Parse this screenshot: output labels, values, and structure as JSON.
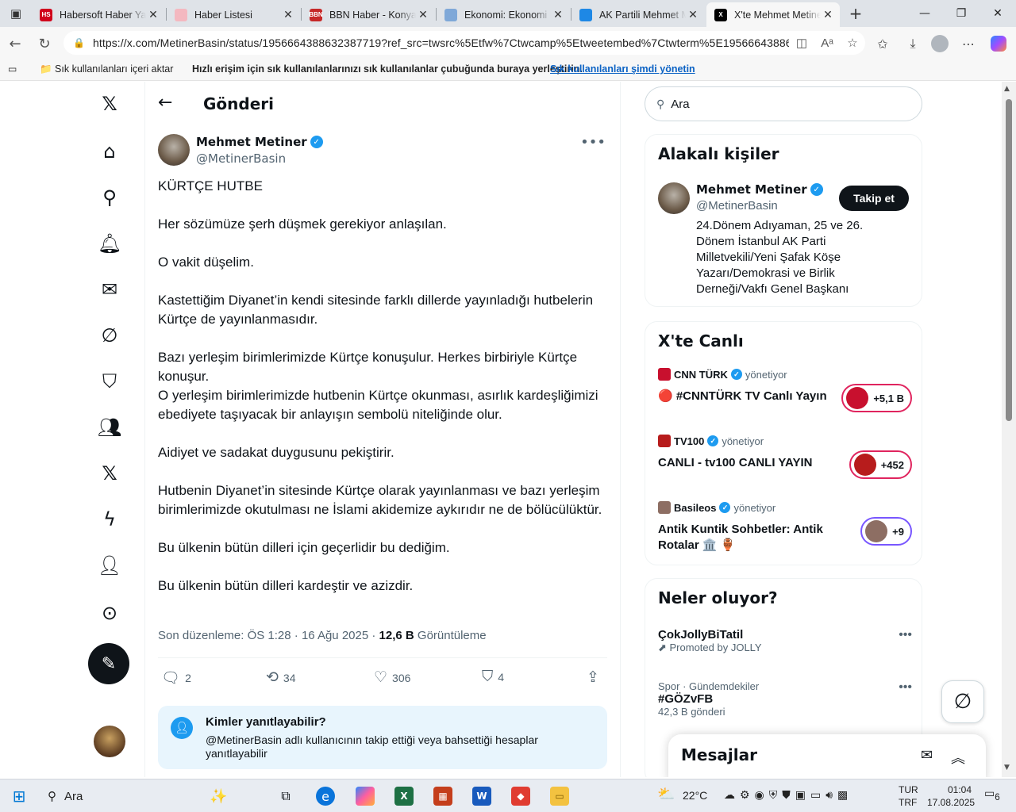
{
  "browser": {
    "tabs": [
      {
        "title": "Habersoft Haber Yaz",
        "fav_color": "#d0021b",
        "fav_text": "HS"
      },
      {
        "title": "Haber Listesi",
        "fav_color": "#f4b8c0",
        "fav_text": ""
      },
      {
        "title": "BBN Haber - Konya -",
        "fav_color": "#c62828",
        "fav_text": "BBN"
      },
      {
        "title": "Ekonomi: Ekonomi H",
        "fav_color": "#7fa8d8",
        "fav_text": ""
      },
      {
        "title": "AK Partili Mehmet M",
        "fav_color": "#1e88e5",
        "fav_text": ""
      },
      {
        "title": "X'te Mehmet Metine",
        "fav_color": "#000000",
        "fav_text": "X"
      }
    ],
    "url": "https://x.com/MetinerBasin/status/1956664388632387719?ref_src=twsrc%5Etfw%7Ctwcamp%5Etweetembed%7Ctwterm%5E195666438863...",
    "favorites_bar": {
      "import": "Sık kullanılanları içeri aktar",
      "hint": "Hızlı erişim için sık kullanılanlarınızı sık kullanılanlar çubuğunda buraya yerleştirin.",
      "manage_link": "Sık kullanılanları şimdi yönetin"
    }
  },
  "header": {
    "title": "Gönderi"
  },
  "post": {
    "author_name": "Mehmet Metiner",
    "author_handle": "@MetinerBasin",
    "paragraphs": [
      "KÜRTÇE HUTBE",
      "Her sözümüze şerh düşmek gerekiyor anlaşılan.",
      "O vakit düşelim.",
      "Kastettiğim Diyanet’in kendi sitesinde farklı dillerde yayınladığı hutbelerin Kürtçe de yayınlanmasıdır.",
      "Bazı yerleşim birimlerimizde Kürtçe konuşulur. Herkes birbiriyle Kürtçe konuşur.\nO yerleşim birimlerimizde hutbenin Kürtçe okunması, asırlık kardeşliğimizi ebediyete taşıyacak bir anlayışın sembolü niteliğinde olur.",
      "Aidiyet ve sadakat duygusunu pekiştirir.",
      "Hutbenin Diyanet’in sitesinde Kürtçe olarak yayınlanması ve bazı yerleşim birimlerimizde okutulması ne İslami akidemize aykırıdır ne de bölücülüktür.",
      "Bu ülkenin bütün dilleri için geçerlidir bu dediğim.",
      "Bu ülkenin bütün dilleri kardeştir ve azizdir."
    ],
    "meta_prefix": "Son düzenleme: ÖS 1:28 · 16 Ağu 2025 · ",
    "views_count": "12,6 B",
    "views_label": " Görüntüleme",
    "replies": "2",
    "reposts": "34",
    "likes": "306",
    "bookmarks": "4",
    "reply_box_title": "Kimler yanıtlayabilir?",
    "reply_box_desc": "@MetinerBasin adlı kullanıcının takip ettiği veya bahsettiği hesaplar yanıtlayabilir"
  },
  "sidebar": {
    "search_placeholder": "Ara",
    "related_title": "Alakalı kişiler",
    "related": {
      "name": "Mehmet Metiner",
      "handle": "@MetinerBasin",
      "follow": "Takip et",
      "bio": "24.Dönem Adıyaman, 25 ve 26. Dönem İstanbul AK Parti Milletvekili/Yeni Şafak Köşe Yazarı/Demokrasi ve Birlik Derneği/Vakfı Genel Başkanı"
    },
    "live_title": "X'te Canlı",
    "live": [
      {
        "host": "CNN TÜRK",
        "role": "yönetiyor",
        "title": "🔴 #CNNTÜRK TV Canlı Yayın",
        "count": "+5,1 B",
        "color": "#c8102e",
        "border": "#e0245e"
      },
      {
        "host": "TV100",
        "role": "yönetiyor",
        "title": "CANLI - tv100 CANLI YAYIN",
        "count": "+452",
        "color": "#b71c1c",
        "border": "#e0245e"
      },
      {
        "host": "Basileos",
        "role": "yönetiyor",
        "title": "Antik Kuntik Sohbetler: Antik Rotalar 🏛️ 🏺",
        "count": "+9",
        "color": "#8d6e63",
        "border": "#7856ff"
      }
    ],
    "trends_title": "Neler oluyor?",
    "trends": [
      {
        "context": "",
        "title": "ÇokJollyBiTatil",
        "sub": "Promoted by JOLLY"
      },
      {
        "context": "Spor · Gündemdekiler",
        "title": "#GÖZvFB",
        "sub": "42,3 B gönderi"
      }
    ],
    "messages_title": "Mesajlar"
  },
  "taskbar": {
    "search": "Ara",
    "temp": "22°C",
    "lang1": "TUR",
    "lang2": "TRF",
    "time": "01:04",
    "date": "17.08.2025",
    "notif": "6"
  }
}
